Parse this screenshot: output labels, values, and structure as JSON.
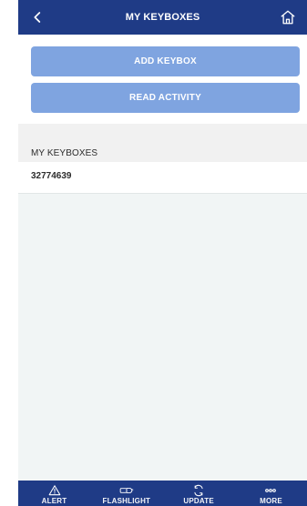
{
  "header": {
    "title": "MY KEYBOXES",
    "back_icon": "chevron-left-icon",
    "home_icon": "home-icon"
  },
  "actions": {
    "add_keybox_label": "ADD KEYBOX",
    "read_activity_label": "READ ACTIVITY"
  },
  "section": {
    "title": "MY KEYBOXES",
    "items": [
      {
        "label": "32774639"
      }
    ]
  },
  "tabbar": {
    "tabs": [
      {
        "label": "ALERT",
        "icon": "warning-icon"
      },
      {
        "label": "FLASHLIGHT",
        "icon": "flashlight-icon"
      },
      {
        "label": "UPDATE",
        "icon": "sync-icon"
      },
      {
        "label": "MORE",
        "icon": "more-icon"
      }
    ]
  },
  "colors": {
    "brand_navy": "#1f3b86",
    "button_blue": "#7fa4e0",
    "section_bg": "#f1f1f1",
    "content_bg": "#f1f5f5",
    "text_dark": "#2c2c2c"
  }
}
